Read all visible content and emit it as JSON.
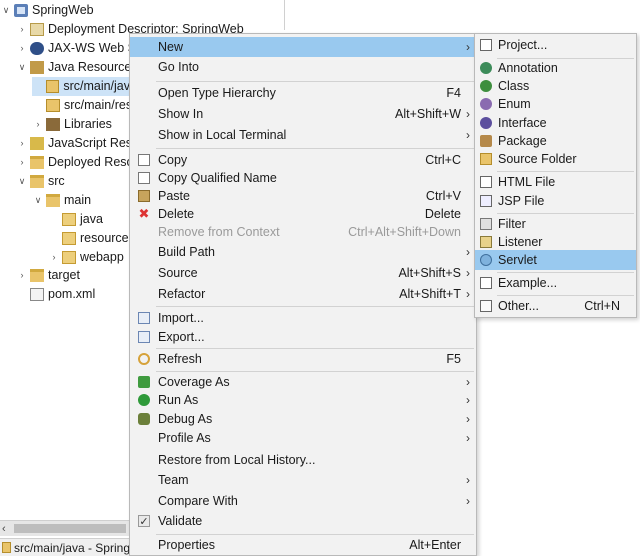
{
  "explorer": {
    "items": [
      {
        "label": "SpringWeb"
      },
      {
        "label": "Deployment Descriptor: SpringWeb"
      },
      {
        "label": "JAX-WS Web Se"
      },
      {
        "label": "Java Resources"
      },
      {
        "label": "src/main/jav"
      },
      {
        "label": "src/main/res"
      },
      {
        "label": "Libraries"
      },
      {
        "label": "JavaScript Reso"
      },
      {
        "label": "Deployed Reso"
      },
      {
        "label": "src"
      },
      {
        "label": "main"
      },
      {
        "label": "java"
      },
      {
        "label": "resources"
      },
      {
        "label": "webapp"
      },
      {
        "label": "target"
      },
      {
        "label": "pom.xml"
      }
    ],
    "status_text": "src/main/java - Spring"
  },
  "context_menu": {
    "items": [
      {
        "label": "New",
        "shortcut": ""
      },
      {
        "label": "Go Into",
        "shortcut": ""
      },
      {
        "label": "Open Type Hierarchy",
        "shortcut": "F4"
      },
      {
        "label": "Show In",
        "shortcut": "Alt+Shift+W"
      },
      {
        "label": "Show in Local Terminal",
        "shortcut": ""
      },
      {
        "label": "Copy",
        "shortcut": "Ctrl+C"
      },
      {
        "label": "Copy Qualified Name",
        "shortcut": ""
      },
      {
        "label": "Paste",
        "shortcut": "Ctrl+V"
      },
      {
        "label": "Delete",
        "shortcut": "Delete"
      },
      {
        "label": "Remove from Context",
        "shortcut": "Ctrl+Alt+Shift+Down"
      },
      {
        "label": "Build Path",
        "shortcut": ""
      },
      {
        "label": "Source",
        "shortcut": "Alt+Shift+S"
      },
      {
        "label": "Refactor",
        "shortcut": "Alt+Shift+T"
      },
      {
        "label": "Import...",
        "shortcut": ""
      },
      {
        "label": "Export...",
        "shortcut": ""
      },
      {
        "label": "Refresh",
        "shortcut": "F5"
      },
      {
        "label": "Coverage As",
        "shortcut": ""
      },
      {
        "label": "Run As",
        "shortcut": ""
      },
      {
        "label": "Debug As",
        "shortcut": ""
      },
      {
        "label": "Profile As",
        "shortcut": ""
      },
      {
        "label": "Restore from Local History...",
        "shortcut": ""
      },
      {
        "label": "Team",
        "shortcut": ""
      },
      {
        "label": "Compare With",
        "shortcut": ""
      },
      {
        "label": "Validate",
        "shortcut": ""
      },
      {
        "label": "Properties",
        "shortcut": "Alt+Enter"
      }
    ]
  },
  "new_submenu": {
    "items": [
      {
        "label": "Project...",
        "shortcut": ""
      },
      {
        "label": "Annotation",
        "shortcut": ""
      },
      {
        "label": "Class",
        "shortcut": ""
      },
      {
        "label": "Enum",
        "shortcut": ""
      },
      {
        "label": "Interface",
        "shortcut": ""
      },
      {
        "label": "Package",
        "shortcut": ""
      },
      {
        "label": "Source Folder",
        "shortcut": ""
      },
      {
        "label": "HTML File",
        "shortcut": ""
      },
      {
        "label": "JSP File",
        "shortcut": ""
      },
      {
        "label": "Filter",
        "shortcut": ""
      },
      {
        "label": "Listener",
        "shortcut": ""
      },
      {
        "label": "Servlet",
        "shortcut": ""
      },
      {
        "label": "Example...",
        "shortcut": ""
      },
      {
        "label": "Other...",
        "shortcut": "Ctrl+N"
      }
    ]
  },
  "colors": {
    "highlight": "#99c9ef",
    "menu_background": "#f2f2f2",
    "tree_selection": "#cde3f7"
  }
}
